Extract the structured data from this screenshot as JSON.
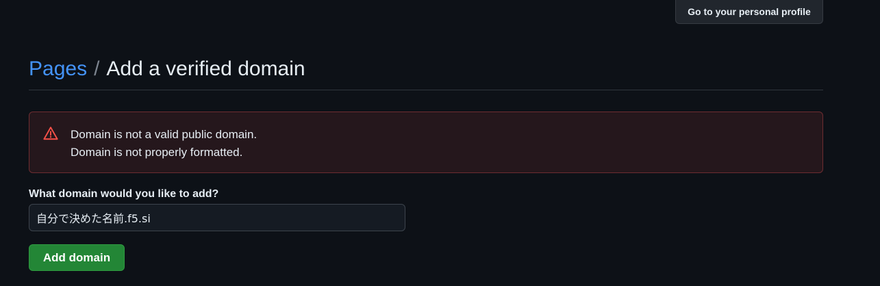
{
  "topbar": {
    "profile_button_label": "Go to your personal profile"
  },
  "header": {
    "breadcrumb_link": "Pages",
    "separator": "/",
    "title": "Add a verified domain"
  },
  "flash": {
    "icon": "alert-triangle-icon",
    "messages": [
      "Domain is not a valid public domain.",
      "Domain is not properly formatted."
    ]
  },
  "form": {
    "label": "What domain would you like to add?",
    "input_value": "自分で決めた名前.f5.si",
    "submit_label": "Add domain"
  },
  "colors": {
    "background": "#0d1117",
    "link": "#4493f8",
    "danger": "#f85149",
    "primary_button": "#238636"
  }
}
